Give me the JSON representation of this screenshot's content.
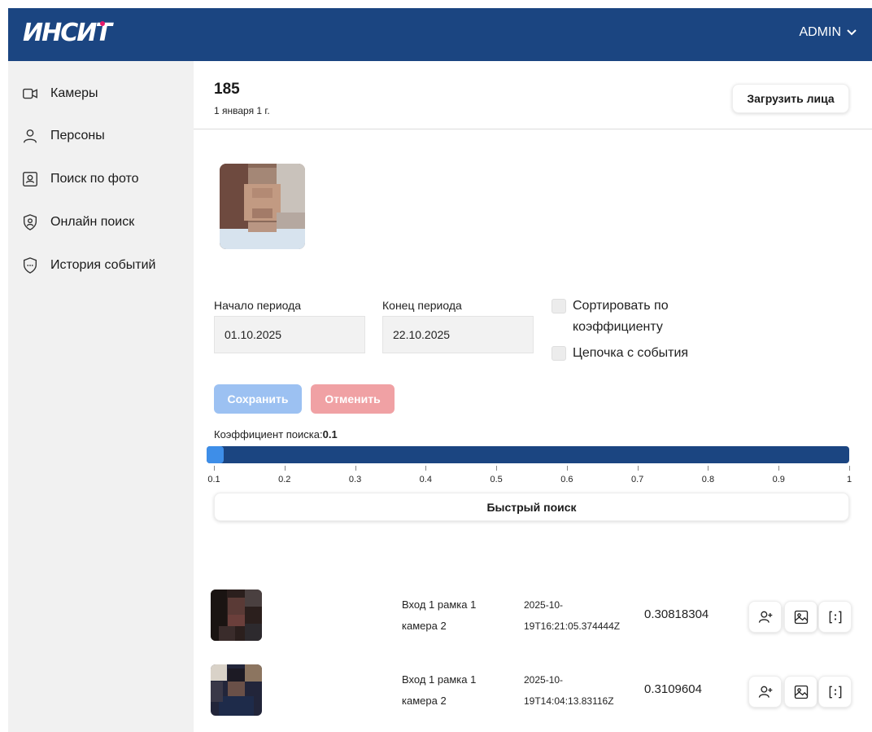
{
  "header": {
    "logo": "ИНСИТ",
    "user": "ADMIN"
  },
  "sidebar": {
    "items": [
      {
        "label": "Камеры",
        "icon": "video-camera-icon"
      },
      {
        "label": "Персоны",
        "icon": "person-icon"
      },
      {
        "label": "Поиск по фото",
        "icon": "portrait-icon"
      },
      {
        "label": "Онлайн поиск",
        "icon": "shield-person-icon"
      },
      {
        "label": "История событий",
        "icon": "shield-dots-icon"
      }
    ]
  },
  "page": {
    "title": "185",
    "date": "1 января 1 г.",
    "upload_label": "Загрузить лица"
  },
  "filters": {
    "start_label": "Начало периода",
    "start_value": "01.10.2025",
    "end_label": "Конец периода",
    "end_value": "22.10.2025",
    "sort_label": "Сортировать по коэффициенту",
    "chain_label": "Цепочка с события",
    "save_label": "Сохранить",
    "cancel_label": "Отменить"
  },
  "slider": {
    "label": "Коэффициент поиска:",
    "value": "0.1",
    "ticks": [
      "0.1",
      "0.2",
      "0.3",
      "0.4",
      "0.5",
      "0.6",
      "0.7",
      "0.8",
      "0.9",
      "1"
    ]
  },
  "quick_search_label": "Быстрый поиск",
  "results": [
    {
      "camera": "Вход 1 рамка 1 камера 2",
      "timestamp": "2025-10-19T16:21:05.374444Z",
      "score": "0.30818304"
    },
    {
      "camera": "Вход 1 рамка 1 камера 2",
      "timestamp": "2025-10-19T14:04:13.83116Z",
      "score": "0.3109604"
    }
  ],
  "colors": {
    "header": "#1b4581",
    "accent_dot": "#e6196b",
    "slider_thumb": "#3e8ee8",
    "save": "#9cc1f2",
    "cancel": "#f0a1a4"
  }
}
